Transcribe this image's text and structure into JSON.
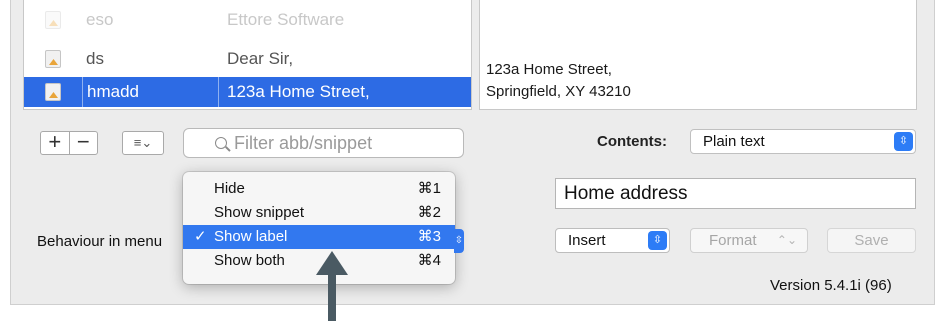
{
  "table": {
    "rows": [
      {
        "abbreviation": "eso",
        "snippet": "Ettore Software",
        "state": "faded"
      },
      {
        "abbreviation": "ds",
        "snippet": "Dear Sir,",
        "state": "normal"
      },
      {
        "abbreviation": "hmadd",
        "snippet": "123a Home Street,",
        "state": "selected"
      }
    ]
  },
  "preview": {
    "lines": [
      "123a Home Street,",
      "Springfield, XY 43210"
    ]
  },
  "toolbar": {
    "add_label": "+",
    "remove_label": "−",
    "list_menu_glyph": "≡⌄",
    "filter_placeholder": "Filter abb/snippet"
  },
  "contents": {
    "label": "Contents:",
    "value": "Plain text"
  },
  "name_field": {
    "value": "Home address"
  },
  "behaviour": {
    "label": "Behaviour in menu"
  },
  "insert": {
    "value": "Insert"
  },
  "format": {
    "value": "Format"
  },
  "save": {
    "label": "Save"
  },
  "version": {
    "text": "Version 5.4.1i (96)"
  },
  "menu": {
    "items": [
      {
        "label": "Hide",
        "shortcut": "⌘1",
        "checked": false
      },
      {
        "label": "Show snippet",
        "shortcut": "⌘2",
        "checked": false
      },
      {
        "label": "Show label",
        "shortcut": "⌘3",
        "checked": true
      },
      {
        "label": "Show both",
        "shortcut": "⌘4",
        "checked": false
      }
    ],
    "check_glyph": "✓"
  },
  "colors": {
    "selection": "#2d6be4",
    "menu_highlight": "#3278ef",
    "stepper": "#2d7cf6",
    "arrow": "#4a5a63"
  },
  "icons": [
    "document-icon",
    "search-icon",
    "list-icon",
    "updown-stepper-icon",
    "checkmark-icon",
    "arrow-annotation"
  ]
}
